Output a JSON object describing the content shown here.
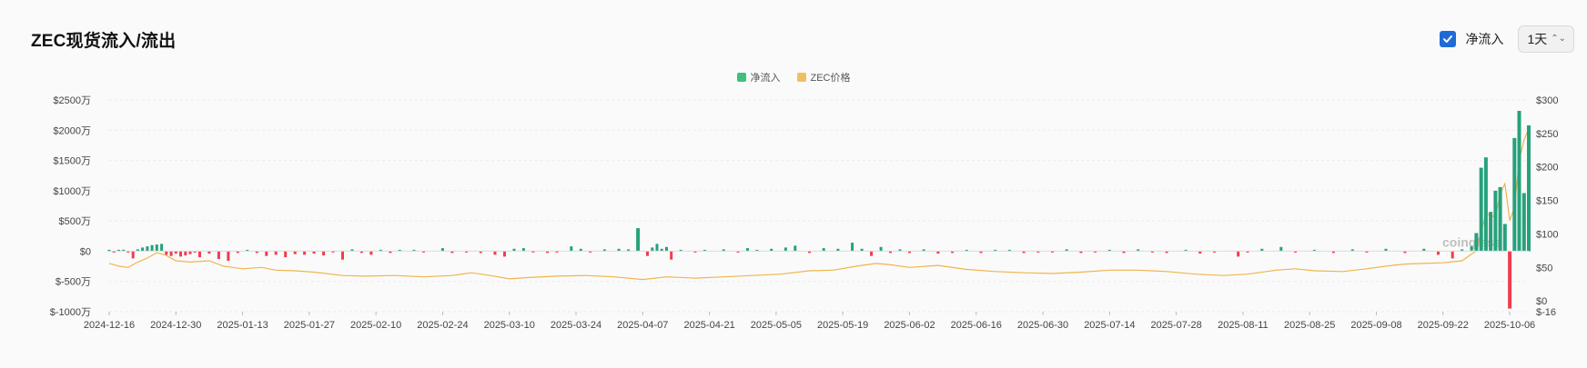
{
  "header": {
    "title": "ZEC现货流入/流出",
    "checkbox_label": "净流入",
    "interval": "1天"
  },
  "watermark": "coinglass",
  "colors": {
    "inflow": "#26a17b",
    "outflow": "#ef3e4f",
    "price": "#f0b44c",
    "legend_inflow": "#3ec07a",
    "checkbox": "#1e6bd6",
    "grid": "#ececec"
  },
  "chart_data": {
    "type": "bar",
    "legend": [
      "净流入",
      "ZEC价格"
    ],
    "x_ticks": [
      "2024-12-16",
      "2024-12-30",
      "2025-01-13",
      "2025-01-27",
      "2025-02-10",
      "2025-02-24",
      "2025-03-10",
      "2025-03-24",
      "2025-04-07",
      "2025-04-21",
      "2025-05-05",
      "2025-05-19",
      "2025-06-02",
      "2025-06-16",
      "2025-06-30",
      "2025-07-14",
      "2025-07-28",
      "2025-08-11",
      "2025-08-25",
      "2025-09-08",
      "2025-09-22",
      "2025-10-06"
    ],
    "x_range": [
      "2024-12-16",
      "2025-10-10"
    ],
    "y_left": {
      "label_unit": "$ (万)",
      "ticks": [
        "$2500万",
        "$2000万",
        "$1500万",
        "$1000万",
        "$500万",
        "$0",
        "$-500万",
        "$-1000万"
      ],
      "range": [
        -1000,
        2500
      ]
    },
    "y_right": {
      "ticks": [
        "$300",
        "$250",
        "$200",
        "$150",
        "$100",
        "$50",
        "$0",
        "$-16"
      ],
      "range": [
        -16,
        300
      ]
    },
    "series": [
      {
        "name": "净流入",
        "unit": "万美元",
        "points": [
          [
            "2024-12-16",
            20
          ],
          [
            "2024-12-17",
            -15
          ],
          [
            "2024-12-18",
            10
          ],
          [
            "2024-12-19",
            25
          ],
          [
            "2024-12-20",
            -20
          ],
          [
            "2024-12-21",
            -120
          ],
          [
            "2024-12-22",
            30
          ],
          [
            "2024-12-23",
            60
          ],
          [
            "2024-12-24",
            80
          ],
          [
            "2024-12-25",
            100
          ],
          [
            "2024-12-26",
            110
          ],
          [
            "2024-12-27",
            120
          ],
          [
            "2024-12-28",
            -60
          ],
          [
            "2024-12-29",
            -80
          ],
          [
            "2024-12-30",
            -40
          ],
          [
            "2024-12-31",
            -90
          ],
          [
            "2025-01-01",
            -70
          ],
          [
            "2025-01-02",
            -50
          ],
          [
            "2025-01-03",
            -20
          ],
          [
            "2025-01-04",
            -100
          ],
          [
            "2025-01-06",
            -40
          ],
          [
            "2025-01-08",
            -130
          ],
          [
            "2025-01-10",
            -160
          ],
          [
            "2025-01-12",
            -30
          ],
          [
            "2025-01-14",
            20
          ],
          [
            "2025-01-16",
            -30
          ],
          [
            "2025-01-18",
            -80
          ],
          [
            "2025-01-20",
            -60
          ],
          [
            "2025-01-22",
            -100
          ],
          [
            "2025-01-24",
            -50
          ],
          [
            "2025-01-26",
            -60
          ],
          [
            "2025-01-28",
            -40
          ],
          [
            "2025-01-30",
            -70
          ],
          [
            "2025-02-01",
            -20
          ],
          [
            "2025-02-03",
            -140
          ],
          [
            "2025-02-05",
            30
          ],
          [
            "2025-02-07",
            -30
          ],
          [
            "2025-02-09",
            -60
          ],
          [
            "2025-02-11",
            20
          ],
          [
            "2025-02-13",
            -30
          ],
          [
            "2025-02-15",
            20
          ],
          [
            "2025-02-18",
            20
          ],
          [
            "2025-02-20",
            -20
          ],
          [
            "2025-02-24",
            50
          ],
          [
            "2025-02-26",
            -30
          ],
          [
            "2025-03-01",
            -20
          ],
          [
            "2025-03-04",
            -30
          ],
          [
            "2025-03-07",
            -60
          ],
          [
            "2025-03-09",
            -90
          ],
          [
            "2025-03-11",
            40
          ],
          [
            "2025-03-13",
            50
          ],
          [
            "2025-03-15",
            -20
          ],
          [
            "2025-03-18",
            -30
          ],
          [
            "2025-03-20",
            -20
          ],
          [
            "2025-03-23",
            80
          ],
          [
            "2025-03-25",
            40
          ],
          [
            "2025-03-27",
            -20
          ],
          [
            "2025-03-30",
            30
          ],
          [
            "2025-04-02",
            40
          ],
          [
            "2025-04-04",
            30
          ],
          [
            "2025-04-06",
            380
          ],
          [
            "2025-04-08",
            -80
          ],
          [
            "2025-04-09",
            60
          ],
          [
            "2025-04-10",
            120
          ],
          [
            "2025-04-11",
            40
          ],
          [
            "2025-04-12",
            70
          ],
          [
            "2025-04-13",
            -140
          ],
          [
            "2025-04-15",
            20
          ],
          [
            "2025-04-18",
            -20
          ],
          [
            "2025-04-20",
            10
          ],
          [
            "2025-04-24",
            30
          ],
          [
            "2025-04-27",
            -20
          ],
          [
            "2025-04-29",
            50
          ],
          [
            "2025-05-01",
            20
          ],
          [
            "2025-05-04",
            40
          ],
          [
            "2025-05-07",
            60
          ],
          [
            "2025-05-09",
            90
          ],
          [
            "2025-05-12",
            -30
          ],
          [
            "2025-05-15",
            50
          ],
          [
            "2025-05-18",
            40
          ],
          [
            "2025-05-21",
            140
          ],
          [
            "2025-05-23",
            40
          ],
          [
            "2025-05-25",
            -80
          ],
          [
            "2025-05-27",
            70
          ],
          [
            "2025-05-29",
            -30
          ],
          [
            "2025-05-31",
            30
          ],
          [
            "2025-06-02",
            -30
          ],
          [
            "2025-06-05",
            30
          ],
          [
            "2025-06-08",
            -40
          ],
          [
            "2025-06-11",
            -30
          ],
          [
            "2025-06-14",
            20
          ],
          [
            "2025-06-17",
            -30
          ],
          [
            "2025-06-20",
            20
          ],
          [
            "2025-06-23",
            20
          ],
          [
            "2025-06-26",
            -30
          ],
          [
            "2025-06-29",
            -20
          ],
          [
            "2025-07-02",
            -20
          ],
          [
            "2025-07-05",
            30
          ],
          [
            "2025-07-08",
            -30
          ],
          [
            "2025-07-11",
            -20
          ],
          [
            "2025-07-14",
            20
          ],
          [
            "2025-07-17",
            -30
          ],
          [
            "2025-07-20",
            30
          ],
          [
            "2025-07-23",
            -20
          ],
          [
            "2025-07-26",
            -30
          ],
          [
            "2025-07-30",
            20
          ],
          [
            "2025-08-02",
            -40
          ],
          [
            "2025-08-05",
            -20
          ],
          [
            "2025-08-10",
            -90
          ],
          [
            "2025-08-12",
            -20
          ],
          [
            "2025-08-15",
            40
          ],
          [
            "2025-08-19",
            70
          ],
          [
            "2025-08-22",
            -20
          ],
          [
            "2025-08-26",
            20
          ],
          [
            "2025-08-30",
            -30
          ],
          [
            "2025-09-03",
            30
          ],
          [
            "2025-09-06",
            -20
          ],
          [
            "2025-09-10",
            40
          ],
          [
            "2025-09-14",
            -30
          ],
          [
            "2025-09-18",
            40
          ],
          [
            "2025-09-21",
            -60
          ],
          [
            "2025-09-24",
            -120
          ],
          [
            "2025-09-26",
            30
          ],
          [
            "2025-09-28",
            80
          ],
          [
            "2025-09-29",
            300
          ],
          [
            "2025-09-30",
            1380
          ],
          [
            "2025-10-01",
            1550
          ],
          [
            "2025-10-02",
            650
          ],
          [
            "2025-10-03",
            1000
          ],
          [
            "2025-10-04",
            1060
          ],
          [
            "2025-10-05",
            450
          ],
          [
            "2025-10-06",
            -950
          ],
          [
            "2025-10-07",
            1870
          ],
          [
            "2025-10-08",
            2320
          ],
          [
            "2025-10-09",
            960
          ],
          [
            "2025-10-10",
            2080
          ]
        ]
      },
      {
        "name": "ZEC价格",
        "unit": "USD",
        "points": [
          [
            "2024-12-16",
            56
          ],
          [
            "2024-12-18",
            52
          ],
          [
            "2024-12-20",
            50
          ],
          [
            "2024-12-22",
            58
          ],
          [
            "2024-12-24",
            64
          ],
          [
            "2024-12-26",
            72
          ],
          [
            "2024-12-28",
            68
          ],
          [
            "2024-12-30",
            60
          ],
          [
            "2025-01-02",
            58
          ],
          [
            "2025-01-06",
            60
          ],
          [
            "2025-01-09",
            52
          ],
          [
            "2025-01-13",
            48
          ],
          [
            "2025-01-17",
            50
          ],
          [
            "2025-01-20",
            46
          ],
          [
            "2025-01-24",
            45
          ],
          [
            "2025-01-28",
            43
          ],
          [
            "2025-02-03",
            38
          ],
          [
            "2025-02-08",
            37
          ],
          [
            "2025-02-14",
            38
          ],
          [
            "2025-02-20",
            36
          ],
          [
            "2025-02-26",
            38
          ],
          [
            "2025-03-02",
            42
          ],
          [
            "2025-03-06",
            38
          ],
          [
            "2025-03-10",
            33
          ],
          [
            "2025-03-14",
            35
          ],
          [
            "2025-03-20",
            37
          ],
          [
            "2025-03-26",
            38
          ],
          [
            "2025-04-01",
            36
          ],
          [
            "2025-04-07",
            32
          ],
          [
            "2025-04-12",
            36
          ],
          [
            "2025-04-18",
            34
          ],
          [
            "2025-04-24",
            36
          ],
          [
            "2025-04-30",
            38
          ],
          [
            "2025-05-06",
            40
          ],
          [
            "2025-05-12",
            45
          ],
          [
            "2025-05-17",
            46
          ],
          [
            "2025-05-22",
            52
          ],
          [
            "2025-05-26",
            56
          ],
          [
            "2025-05-29",
            54
          ],
          [
            "2025-06-02",
            50
          ],
          [
            "2025-06-08",
            53
          ],
          [
            "2025-06-14",
            47
          ],
          [
            "2025-06-20",
            44
          ],
          [
            "2025-06-26",
            42
          ],
          [
            "2025-07-02",
            41
          ],
          [
            "2025-07-08",
            43
          ],
          [
            "2025-07-14",
            46
          ],
          [
            "2025-07-20",
            46
          ],
          [
            "2025-07-26",
            44
          ],
          [
            "2025-08-01",
            40
          ],
          [
            "2025-08-07",
            38
          ],
          [
            "2025-08-12",
            40
          ],
          [
            "2025-08-18",
            46
          ],
          [
            "2025-08-22",
            48
          ],
          [
            "2025-08-26",
            45
          ],
          [
            "2025-09-01",
            44
          ],
          [
            "2025-09-06",
            48
          ],
          [
            "2025-09-10",
            52
          ],
          [
            "2025-09-14",
            55
          ],
          [
            "2025-09-18",
            56
          ],
          [
            "2025-09-22",
            57
          ],
          [
            "2025-09-26",
            60
          ],
          [
            "2025-09-29",
            75
          ],
          [
            "2025-10-01",
            130
          ],
          [
            "2025-10-03",
            125
          ],
          [
            "2025-10-04",
            160
          ],
          [
            "2025-10-05",
            175
          ],
          [
            "2025-10-06",
            120
          ],
          [
            "2025-10-07",
            140
          ],
          [
            "2025-10-08",
            210
          ],
          [
            "2025-10-09",
            240
          ],
          [
            "2025-10-10",
            258
          ]
        ]
      }
    ],
    "grid": "horizontal dashed",
    "legend_position": "top-center"
  }
}
